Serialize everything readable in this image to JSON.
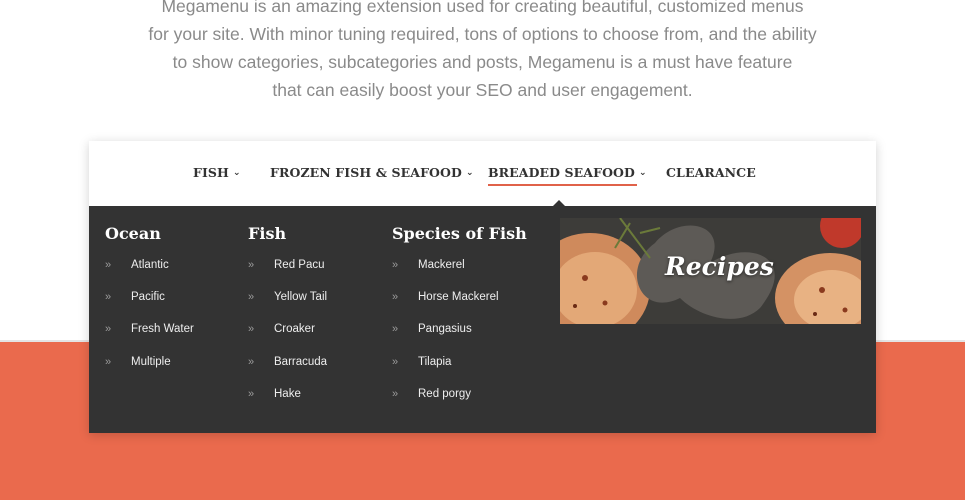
{
  "intro": {
    "lines": [
      "Megamenu is an amazing extension used for creating beautiful, customized menus",
      "for your site. With minor tuning required, tons of options to choose from, and the ability",
      "to show categories, subcategories and posts, Megamenu is a must have feature",
      "that can easily boost your SEO and user engagement."
    ]
  },
  "nav": {
    "items": [
      {
        "label": "FISH",
        "has_dropdown": true
      },
      {
        "label": "FROZEN FISH & SEAFOOD",
        "has_dropdown": true
      },
      {
        "label": "BREADED SEAFOOD",
        "has_dropdown": true,
        "active": true
      },
      {
        "label": "CLEARANCE",
        "has_dropdown": false
      }
    ],
    "chevron": "⌄"
  },
  "columns": [
    {
      "title": "Ocean",
      "items": [
        "Atlantic",
        "Pacific",
        "Fresh Water",
        "Multiple"
      ]
    },
    {
      "title": "Fish",
      "items": [
        "Red Pacu",
        "Yellow Tail",
        "Croaker",
        "Barracuda",
        "Hake"
      ]
    },
    {
      "title": "Species of Fish",
      "items": [
        "Mackerel",
        "Horse Mackerel",
        "Pangasius",
        "Tilapia",
        "Red porgy"
      ]
    }
  ],
  "bullet_glyph": "»",
  "promo": {
    "label": "Recipes"
  },
  "colors": {
    "accent": "#e0624a",
    "footer_bg": "#ea6a4d",
    "panel_bg": "#333333",
    "intro_text": "#8a8a8a"
  }
}
